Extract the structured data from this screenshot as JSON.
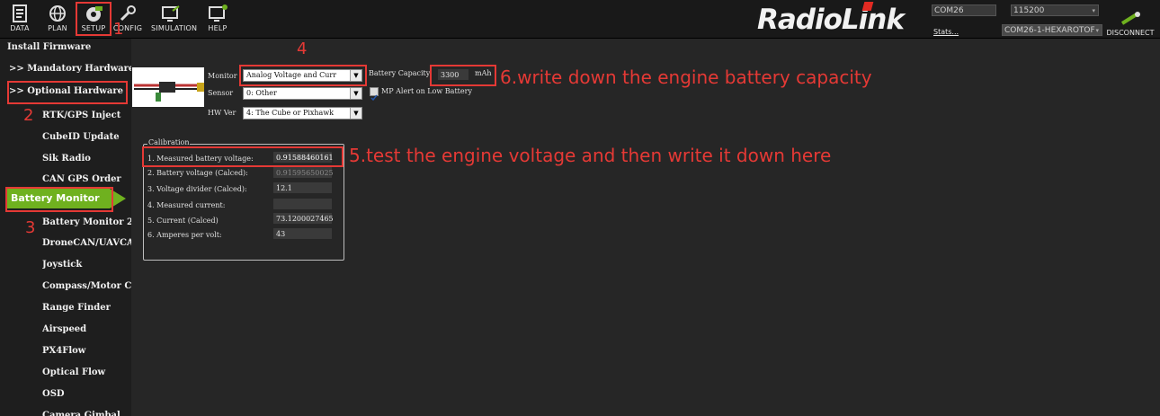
{
  "toolbar": {
    "data": "DATA",
    "plan": "PLAN",
    "setup": "SETUP",
    "config": "CONFIG",
    "simulation": "SIMULATION",
    "help": "HELP"
  },
  "brand": {
    "logo": "RadioLink"
  },
  "connection": {
    "port": "COM26",
    "baud": "115200",
    "stats": "Stats...",
    "link": "COM26-1-HEXAROTOF",
    "disconnect": "DISCONNECT"
  },
  "sidebar": {
    "install_firmware": "Install Firmware",
    "mandatory_hardware": ">> Mandatory Hardware",
    "optional_hardware": ">> Optional Hardware",
    "active": "Battery Monitor",
    "items": [
      "RTK/GPS Inject",
      "CubeID Update",
      "Sik Radio",
      "CAN GPS Order",
      "Battery Monitor",
      "Battery Monitor 2",
      "DroneCAN/UAVCAN",
      "Joystick",
      "Compass/Motor Calib",
      "Range Finder",
      "Airspeed",
      "PX4Flow",
      "Optical Flow",
      "OSD",
      "Camera Gimbal"
    ]
  },
  "battery": {
    "monitor_label": "Monitor",
    "monitor_value": "Analog Voltage and Curr",
    "sensor_label": "Sensor",
    "sensor_value": "0: Other",
    "hwver_label": "HW Ver",
    "hwver_value": "4: The Cube or Pixhawk",
    "capacity_label": "Battery Capacity",
    "capacity_value": "3300",
    "capacity_unit": "mAh",
    "alert_label": "MP Alert on Low Battery",
    "alert_checked": true
  },
  "calibration": {
    "title": "Calibration",
    "rows": [
      {
        "label": "1. Measured battery voltage:",
        "value": "0.91588460161"
      },
      {
        "label": "2. Battery voltage (Calced):",
        "value": "0.91595650025"
      },
      {
        "label": "3. Voltage divider (Calced):",
        "value": "12.1"
      },
      {
        "label": "4. Measured current:",
        "value": ""
      },
      {
        "label": "5. Current (Calced)",
        "value": "73.1200027465"
      },
      {
        "label": "6. Amperes per volt:",
        "value": "43"
      }
    ]
  },
  "annotations": {
    "n1": "1",
    "n2": "2",
    "n3": "3",
    "n4": "4",
    "step5": "5.test the engine voltage and then write it down here",
    "step6": "6.write down the engine battery capacity"
  },
  "colors": {
    "accent_green": "#6fb11f",
    "annotation_red": "#e53935",
    "background": "#262626"
  }
}
